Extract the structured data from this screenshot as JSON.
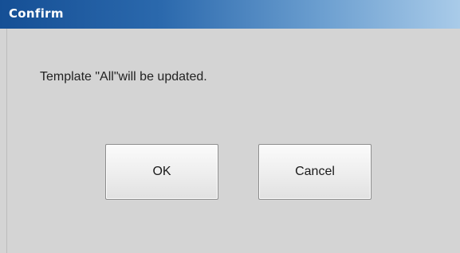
{
  "dialog": {
    "title": "Confirm",
    "message": "Template \"All\"will be updated.",
    "buttons": {
      "ok_label": "OK",
      "cancel_label": "Cancel"
    }
  },
  "colors": {
    "titlebar_start": "#154f95",
    "titlebar_end": "#a9cbe9",
    "background": "#d4d4d4"
  }
}
